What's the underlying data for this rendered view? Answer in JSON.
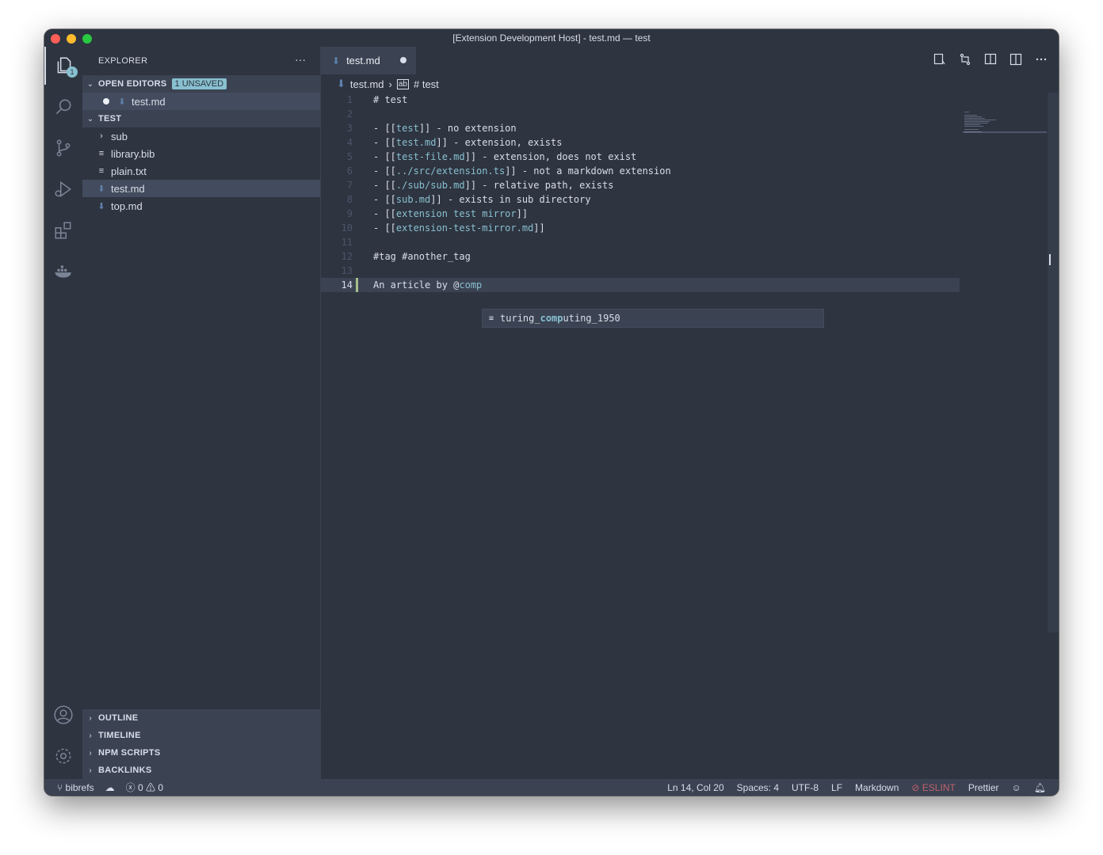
{
  "window": {
    "title": "[Extension Development Host] - test.md — test"
  },
  "activity_bar": {
    "explorer_badge": "1"
  },
  "explorer": {
    "header": "EXPLORER",
    "more": "···",
    "open_editors": {
      "label": "OPEN EDITORS",
      "badge": "1 UNSAVED",
      "items": [
        "test.md"
      ]
    },
    "folder": {
      "label": "TEST",
      "items": [
        "sub",
        "library.bib",
        "plain.txt",
        "test.md",
        "top.md"
      ]
    },
    "bottom_sections": [
      "OUTLINE",
      "TIMELINE",
      "NPM SCRIPTS",
      "BACKLINKS"
    ]
  },
  "editor": {
    "tab": {
      "label": "test.md"
    },
    "breadcrumb": {
      "file": "test.md",
      "symbol": "# test"
    },
    "lines": [
      {
        "n": "1"
      },
      {
        "n": "2"
      },
      {
        "n": "3"
      },
      {
        "n": "4"
      },
      {
        "n": "5"
      },
      {
        "n": "6"
      },
      {
        "n": "7"
      },
      {
        "n": "8"
      },
      {
        "n": "9"
      },
      {
        "n": "10"
      },
      {
        "n": "11"
      },
      {
        "n": "12"
      },
      {
        "n": "13"
      },
      {
        "n": "14"
      }
    ],
    "content": {
      "l1": "# test",
      "l3a": "- [[",
      "l3b": "test",
      "l3c": "]] - no extension",
      "l4a": "- [[",
      "l4b": "test.md",
      "l4c": "]] - extension, exists",
      "l5a": "- [[",
      "l5b": "test-file.md",
      "l5c": "]] - extension, does not exist",
      "l6a": "- [[",
      "l6b": "../src/extension.ts",
      "l6c": "]] - not a markdown extension",
      "l7a": "- [[",
      "l7b": "./sub/sub.md",
      "l7c": "]] - relative path, exists",
      "l8a": "- [[",
      "l8b": "sub.md",
      "l8c": "]] - exists in sub directory",
      "l9a": "- [[",
      "l9b": "extension test mirror",
      "l9c": "]]",
      "l10a": "- [[",
      "l10b": "extension-test-mirror.md",
      "l10c": "]]",
      "l12": "#tag #another_tag",
      "l14a": "An article by @",
      "l14b": "comp"
    },
    "suggestion": {
      "pre": "turing_",
      "match": "comp",
      "post": "uting_1950"
    }
  },
  "statusbar": {
    "branch": "bibrefs",
    "errors": "0",
    "warnings": "0",
    "position": "Ln 14, Col 20",
    "spaces": "Spaces: 4",
    "encoding": "UTF-8",
    "eol": "LF",
    "language": "Markdown",
    "eslint": "ESLINT",
    "prettier": "Prettier"
  },
  "colors": {
    "background": "#2e3440",
    "accent": "#88c0d0",
    "error": "#bf616a",
    "modified": "#a3be8c"
  }
}
